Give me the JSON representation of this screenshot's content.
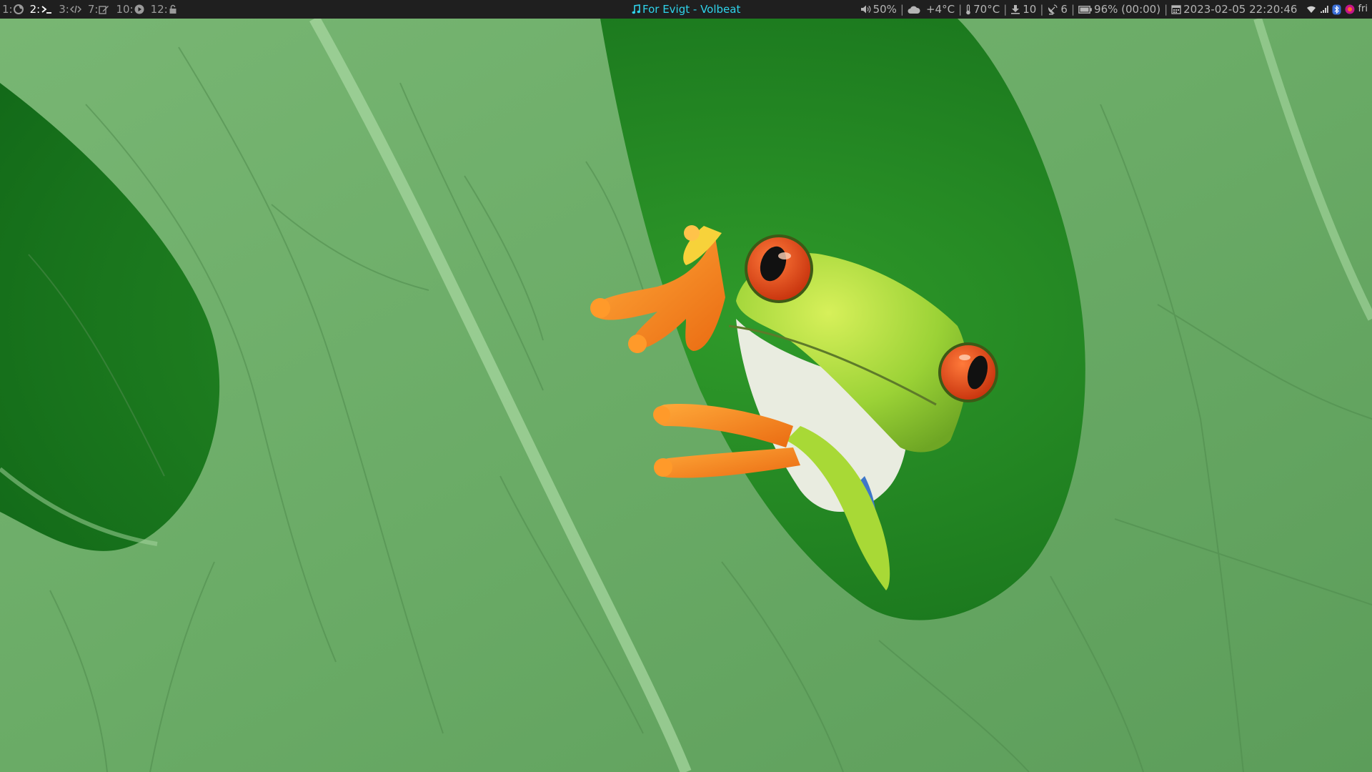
{
  "workspaces": [
    {
      "num": "1:",
      "icon": "firefox-icon",
      "active": false
    },
    {
      "num": "2:",
      "icon": "terminal-icon",
      "active": true
    },
    {
      "num": "3:",
      "icon": "code-icon",
      "active": false
    },
    {
      "num": "7:",
      "icon": "edit-icon",
      "active": false
    },
    {
      "num": "10:",
      "icon": "play-icon",
      "active": false
    },
    {
      "num": "12:",
      "icon": "lock-icon",
      "active": false
    }
  ],
  "now_playing": {
    "text": "For Evigt - Volbeat",
    "icon": "music-note-icon",
    "color": "#2fd3ea"
  },
  "status": {
    "volume": "50%",
    "weather": "+4°C",
    "cpu_temp": "70°C",
    "updates": "10",
    "network_count": "6",
    "battery": "96% (00:00)",
    "datetime": "2023-02-05 22:20:46",
    "separator": "|"
  },
  "tray": {
    "items": [
      "wifi-icon",
      "signal-bars-icon",
      "bluetooth-icon",
      "app-tray-icon"
    ],
    "text": "fri"
  },
  "colors": {
    "bar_bg": "#1f1f1f",
    "bar_text": "#b4b4b4",
    "active_workspace": "#ffffff",
    "accent": "#2fd3ea",
    "leaf": "#6fb26a",
    "background_green": "#167a1e",
    "frog_green": "#a5d83b",
    "frog_orange": "#f2801f",
    "frog_eye": "#e8461a"
  }
}
